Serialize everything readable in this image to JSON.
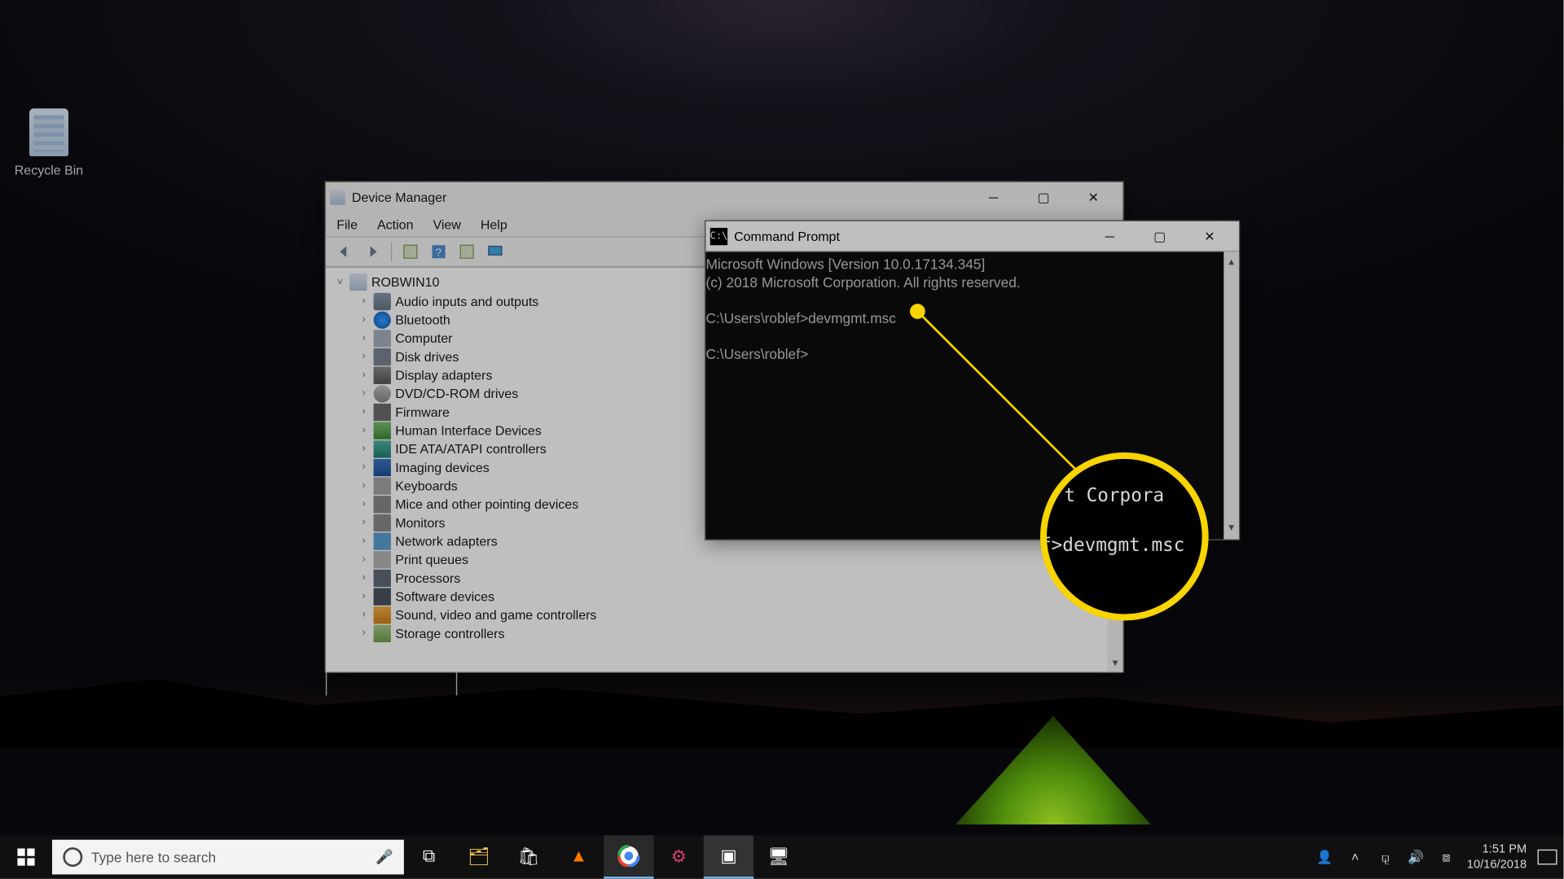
{
  "desktop": {
    "recycle_label": "Recycle Bin"
  },
  "devmgr": {
    "title": "Device Manager",
    "menus": [
      "File",
      "Action",
      "View",
      "Help"
    ],
    "root": "ROBWIN10",
    "items": [
      "Audio inputs and outputs",
      "Bluetooth",
      "Computer",
      "Disk drives",
      "Display adapters",
      "DVD/CD-ROM drives",
      "Firmware",
      "Human Interface Devices",
      "IDE ATA/ATAPI controllers",
      "Imaging devices",
      "Keyboards",
      "Mice and other pointing devices",
      "Monitors",
      "Network adapters",
      "Print queues",
      "Processors",
      "Software devices",
      "Sound, video and game controllers",
      "Storage controllers"
    ]
  },
  "cmd": {
    "title": "Command Prompt",
    "line1": "Microsoft Windows [Version 10.0.17134.345]",
    "line2": "(c) 2018 Microsoft Corporation. All rights reserved.",
    "prompt1": "C:\\Users\\roblef>devmgmt.msc",
    "prompt2": "C:\\Users\\roblef>"
  },
  "callout": {
    "mag_line1": "t Corpora",
    "mag_line2": "f>devmgmt.msc"
  },
  "taskbar": {
    "search_placeholder": "Type here to search",
    "time": "1:51 PM",
    "date": "10/16/2018"
  }
}
